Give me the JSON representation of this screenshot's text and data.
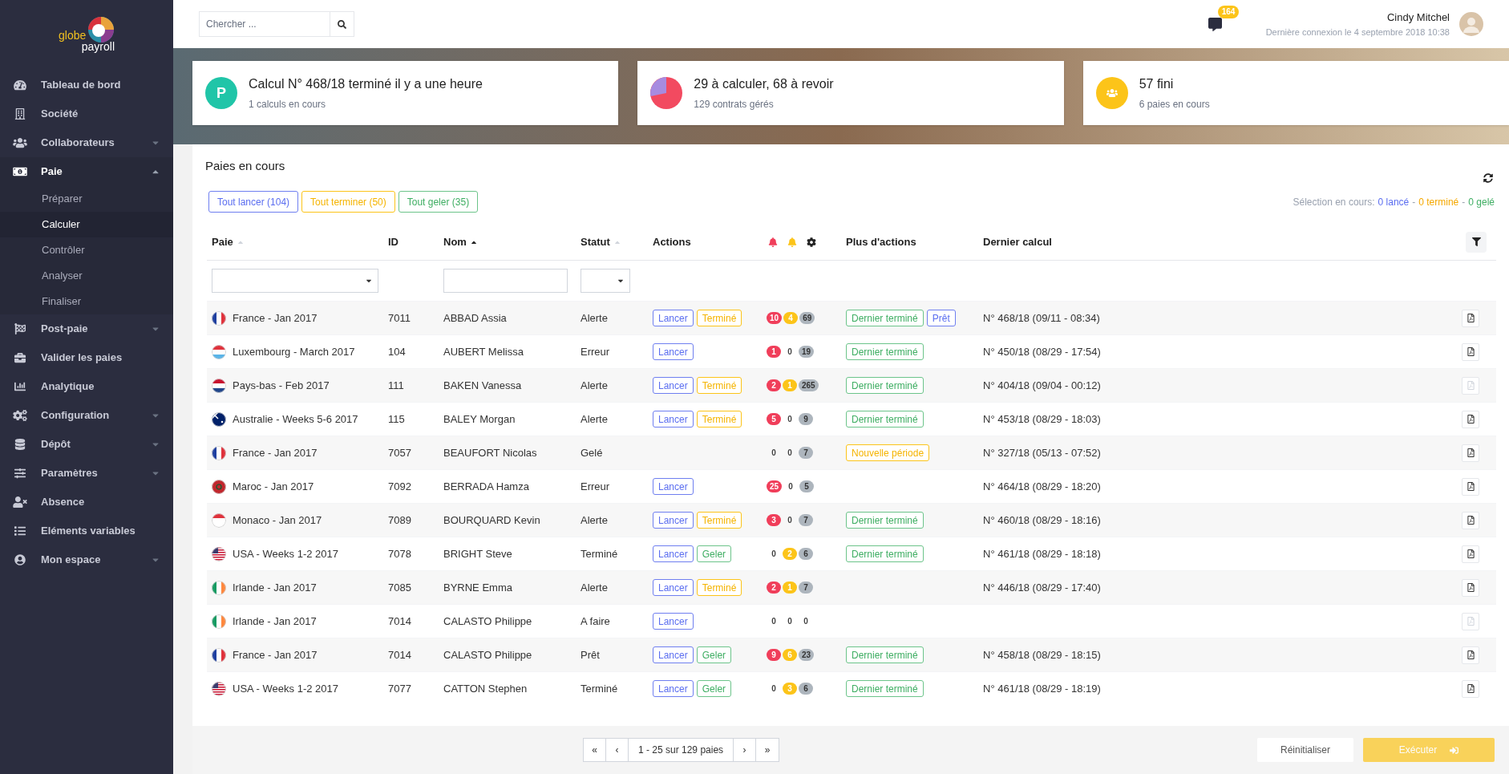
{
  "logo": {
    "word_1": "globe",
    "word_2": "payroll"
  },
  "sidebar": {
    "items": [
      {
        "label": "Tableau de bord",
        "has_children": false,
        "expanded": false
      },
      {
        "label": "Société",
        "has_children": false,
        "expanded": false
      },
      {
        "label": "Collaborateurs",
        "has_children": true,
        "expanded": false
      },
      {
        "label": "Paie",
        "has_children": true,
        "expanded": true,
        "children": [
          {
            "label": "Préparer",
            "selected": false
          },
          {
            "label": "Calculer",
            "selected": true
          },
          {
            "label": "Contrôler",
            "selected": false
          },
          {
            "label": "Analyser",
            "selected": false
          },
          {
            "label": "Finaliser",
            "selected": false
          }
        ]
      },
      {
        "label": "Post-paie",
        "has_children": true,
        "expanded": false
      },
      {
        "label": "Valider les paies",
        "has_children": false,
        "expanded": false
      },
      {
        "label": "Analytique",
        "has_children": false,
        "expanded": false
      },
      {
        "label": "Configuration",
        "has_children": true,
        "expanded": false
      },
      {
        "label": "Dépôt",
        "has_children": true,
        "expanded": false
      },
      {
        "label": "Paramètres",
        "has_children": true,
        "expanded": false
      },
      {
        "label": "Absence",
        "has_children": false,
        "expanded": false
      },
      {
        "label": "Eléments variables",
        "has_children": false,
        "expanded": false
      },
      {
        "label": "Mon espace",
        "has_children": true,
        "expanded": false
      }
    ]
  },
  "topbar": {
    "search": {
      "placeholder": "Chercher ..."
    },
    "messages_badge": "164",
    "user": {
      "name": "Cindy Mitchel",
      "last_login": "Dernière connexion le 4 septembre 2018 10:38"
    }
  },
  "cards": [
    {
      "kind": "letter",
      "icon_text": "P",
      "title": "Calcul N° 468/18 terminé il y a une heure",
      "subtitle": "1 calculs en cours"
    },
    {
      "kind": "pie",
      "title": "29 à calculer, 68 à revoir",
      "subtitle": "129 contrats gérés"
    },
    {
      "kind": "people",
      "title": "57 fini",
      "subtitle": "6 paies en cours"
    }
  ],
  "panel": {
    "title": "Paies en cours",
    "bulk_buttons": [
      {
        "label": "Tout lancer (104)",
        "kind": "blue"
      },
      {
        "label": "Tout terminer (50)",
        "kind": "amber"
      },
      {
        "label": "Tout geler (35)",
        "kind": "green"
      }
    ],
    "selection": [
      {
        "text": "Sélection en cours:",
        "kind": "gray"
      },
      {
        "text": "0 lancé",
        "kind": "blue"
      },
      {
        "text": "-",
        "kind": "gray"
      },
      {
        "text": "0 terminé",
        "kind": "amber"
      },
      {
        "text": "-",
        "kind": "gray"
      },
      {
        "text": "0 gelé",
        "kind": "green"
      }
    ],
    "columns": [
      {
        "label": "Paie",
        "sorted": false
      },
      {
        "label": "ID"
      },
      {
        "label": "Nom",
        "sorted": true
      },
      {
        "label": "Statut",
        "sorted": false
      },
      {
        "label": "Actions"
      },
      {
        "label": "Plus d'actions"
      },
      {
        "label": "Dernier calcul"
      }
    ],
    "rows": [
      {
        "paie": "France - Jan 2017",
        "id": "7011",
        "nom": "ABBAD Assia",
        "statut": "Alerte",
        "actions": [
          {
            "label": "Lancer",
            "kind": "blue"
          },
          {
            "label": "Terminé",
            "kind": "amber"
          }
        ],
        "counts": [
          {
            "value": "10",
            "kind": "red"
          },
          {
            "value": "4",
            "kind": "amber"
          },
          {
            "value": "69",
            "kind": "gray"
          }
        ],
        "more": [
          {
            "label": "Dernier terminé",
            "kind": "green"
          },
          {
            "label": "Prêt",
            "kind": "blue"
          }
        ],
        "last": "N° 468/18 (09/11 - 08:34)",
        "pdf_disabled": false
      },
      {
        "paie": "Luxembourg - March 2017",
        "id": "104",
        "nom": "AUBERT Melissa",
        "statut": "Erreur",
        "actions": [
          {
            "label": "Lancer",
            "kind": "blue"
          }
        ],
        "counts": [
          {
            "value": "1",
            "kind": "red"
          },
          {
            "value": "0",
            "kind": "plain"
          },
          {
            "value": "19",
            "kind": "gray"
          }
        ],
        "more": [
          {
            "label": "Dernier terminé",
            "kind": "green"
          }
        ],
        "last": "N° 450/18 (08/29 - 17:54)",
        "pdf_disabled": false
      },
      {
        "paie": "Pays-bas - Feb 2017",
        "id": "111",
        "nom": "BAKEN Vanessa",
        "statut": "Alerte",
        "actions": [
          {
            "label": "Lancer",
            "kind": "blue"
          },
          {
            "label": "Terminé",
            "kind": "amber"
          }
        ],
        "counts": [
          {
            "value": "2",
            "kind": "red"
          },
          {
            "value": "1",
            "kind": "amber"
          },
          {
            "value": "265",
            "kind": "gray"
          }
        ],
        "more": [
          {
            "label": "Dernier terminé",
            "kind": "green"
          }
        ],
        "last": "N° 404/18 (09/04 - 00:12)",
        "pdf_disabled": true
      },
      {
        "paie": "Australie - Weeks 5-6 2017",
        "id": "115",
        "nom": "BALEY Morgan",
        "statut": "Alerte",
        "actions": [
          {
            "label": "Lancer",
            "kind": "blue"
          },
          {
            "label": "Terminé",
            "kind": "amber"
          }
        ],
        "counts": [
          {
            "value": "5",
            "kind": "red"
          },
          {
            "value": "0",
            "kind": "plain"
          },
          {
            "value": "9",
            "kind": "gray"
          }
        ],
        "more": [
          {
            "label": "Dernier terminé",
            "kind": "green"
          }
        ],
        "last": "N° 453/18 (08/29 - 18:03)",
        "pdf_disabled": false
      },
      {
        "paie": "France - Jan 2017",
        "id": "7057",
        "nom": "BEAUFORT Nicolas",
        "statut": "Gelé",
        "counts": [
          {
            "value": "0",
            "kind": "plain"
          },
          {
            "value": "0",
            "kind": "plain"
          },
          {
            "value": "7",
            "kind": "gray"
          }
        ],
        "more": [
          {
            "label": "Nouvelle période",
            "kind": "amber"
          }
        ],
        "last": "N° 327/18 (05/13 - 07:52)",
        "pdf_disabled": false
      },
      {
        "paie": "Maroc - Jan 2017",
        "id": "7092",
        "nom": "BERRADA Hamza",
        "statut": "Erreur",
        "actions": [
          {
            "label": "Lancer",
            "kind": "blue"
          }
        ],
        "counts": [
          {
            "value": "25",
            "kind": "red"
          },
          {
            "value": "0",
            "kind": "plain"
          },
          {
            "value": "5",
            "kind": "gray"
          }
        ],
        "last": "N° 464/18 (08/29 - 18:20)",
        "pdf_disabled": false
      },
      {
        "paie": "Monaco - Jan 2017",
        "id": "7089",
        "nom": "BOURQUARD Kevin",
        "statut": "Alerte",
        "actions": [
          {
            "label": "Lancer",
            "kind": "blue"
          },
          {
            "label": "Terminé",
            "kind": "amber"
          }
        ],
        "counts": [
          {
            "value": "3",
            "kind": "red"
          },
          {
            "value": "0",
            "kind": "plain"
          },
          {
            "value": "7",
            "kind": "gray"
          }
        ],
        "more": [
          {
            "label": "Dernier terminé",
            "kind": "green"
          }
        ],
        "last": "N° 460/18 (08/29 - 18:16)",
        "pdf_disabled": false
      },
      {
        "paie": "USA - Weeks 1-2 2017",
        "id": "7078",
        "nom": "BRIGHT Steve",
        "statut": "Terminé",
        "actions": [
          {
            "label": "Lancer",
            "kind": "blue"
          },
          {
            "label": "Geler",
            "kind": "green"
          }
        ],
        "counts": [
          {
            "value": "0",
            "kind": "plain"
          },
          {
            "value": "2",
            "kind": "amber"
          },
          {
            "value": "6",
            "kind": "gray"
          }
        ],
        "more": [
          {
            "label": "Dernier terminé",
            "kind": "green"
          }
        ],
        "last": "N° 461/18 (08/29 - 18:18)",
        "pdf_disabled": false
      },
      {
        "paie": "Irlande - Jan 2017",
        "id": "7085",
        "nom": "BYRNE Emma",
        "statut": "Alerte",
        "actions": [
          {
            "label": "Lancer",
            "kind": "blue"
          },
          {
            "label": "Terminé",
            "kind": "amber"
          }
        ],
        "counts": [
          {
            "value": "2",
            "kind": "red"
          },
          {
            "value": "1",
            "kind": "amber"
          },
          {
            "value": "7",
            "kind": "gray"
          }
        ],
        "last": "N° 446/18 (08/29 - 17:40)",
        "pdf_disabled": false
      },
      {
        "paie": "Irlande - Jan 2017",
        "id": "7014",
        "nom": "CALASTO Philippe",
        "statut": "A faire",
        "actions": [
          {
            "label": "Lancer",
            "kind": "blue"
          }
        ],
        "counts": [
          {
            "value": "0",
            "kind": "plain"
          },
          {
            "value": "0",
            "kind": "plain"
          },
          {
            "value": "0",
            "kind": "plain"
          }
        ],
        "pdf_disabled": true
      },
      {
        "paie": "France - Jan 2017",
        "id": "7014",
        "nom": "CALASTO Philippe",
        "statut": "Prêt",
        "actions": [
          {
            "label": "Lancer",
            "kind": "blue"
          },
          {
            "label": "Geler",
            "kind": "green"
          }
        ],
        "counts": [
          {
            "value": "9",
            "kind": "red"
          },
          {
            "value": "6",
            "kind": "amber"
          },
          {
            "value": "23",
            "kind": "gray"
          }
        ],
        "more": [
          {
            "label": "Dernier terminé",
            "kind": "green"
          }
        ],
        "last": "N° 458/18 (08/29 - 18:15)",
        "pdf_disabled": false
      },
      {
        "paie": "USA - Weeks 1-2 2017",
        "id": "7077",
        "nom": "CATTON Stephen",
        "statut": "Terminé",
        "actions": [
          {
            "label": "Lancer",
            "kind": "blue"
          },
          {
            "label": "Geler",
            "kind": "green"
          }
        ],
        "counts": [
          {
            "value": "0",
            "kind": "plain"
          },
          {
            "value": "3",
            "kind": "amber"
          },
          {
            "value": "6",
            "kind": "gray"
          }
        ],
        "more": [
          {
            "label": "Dernier terminé",
            "kind": "green"
          }
        ],
        "last": "N° 461/18 (08/29 - 18:19)",
        "pdf_disabled": false
      }
    ],
    "pagination": {
      "first": "«",
      "prev": "‹",
      "info": "1 - 25 sur 129 paies",
      "next": "›",
      "last": "»"
    },
    "footer_buttons": [
      {
        "label": "Réinitialiser",
        "kind": "secondary",
        "disabled": false
      },
      {
        "label": "Exécuter",
        "kind": "primary",
        "disabled": true
      }
    ]
  }
}
